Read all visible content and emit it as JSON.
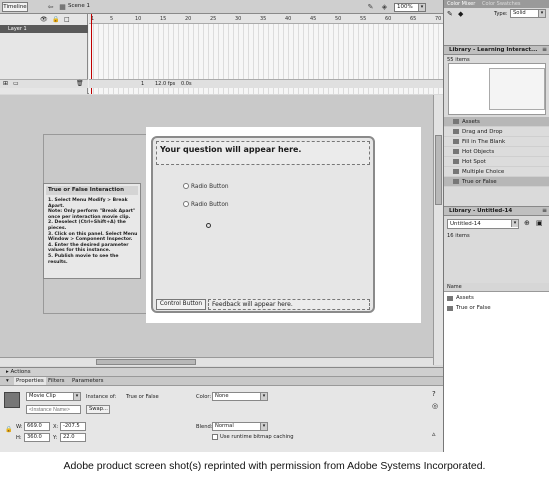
{
  "topbar": {
    "timeline_tab": "Timeline",
    "scene": "Scene 1",
    "zoom": "100%"
  },
  "timeline": {
    "layer_name": "Layer 1",
    "ruler_ticks": [
      "1",
      "5",
      "10",
      "15",
      "20",
      "25",
      "30",
      "35",
      "40",
      "45",
      "50",
      "55",
      "60",
      "65",
      "70"
    ],
    "status_frame": "1",
    "status_fps": "12.0 fps",
    "status_time": "0.0s"
  },
  "stage": {
    "info_panel": {
      "title": "True or False Interaction",
      "steps": [
        "1. Select Menu Modify > Break Apart.",
        "   Note: Only perform \"Break Apart\"",
        "   once per interaction movie clip.",
        "2. Deselect (Ctrl+Shift+A) the pieces.",
        "3. Click on this panel. Select Menu",
        "   Window > Component Inspector.",
        "4. Enter the desired parameter",
        "   values for this instance.",
        "5. Publish movie to see the results."
      ]
    },
    "question": "Your question will appear here.",
    "radio1": "Radio Button",
    "radio2": "Radio Button",
    "control_button": "Control Button",
    "feedback": "Feedback will appear here."
  },
  "actions_label": "Actions",
  "properties": {
    "tabs": [
      "Properties",
      "Filters",
      "Parameters"
    ],
    "symbol_type": "Movie Clip",
    "instance_of_label": "Instance of:",
    "instance_of_value": "True or False",
    "instance_name_placeholder": "<Instance Name>",
    "swap_label": "Swap...",
    "color_label": "Color:",
    "color_value": "None",
    "blend_label": "Blend:",
    "blend_value": "Normal",
    "bitmap_caching": "Use runtime bitmap caching",
    "w_label": "W:",
    "w_value": "669.0",
    "x_label": "X:",
    "x_value": "-207.5",
    "h_label": "H:",
    "h_value": "360.0",
    "y_label": "Y:",
    "y_value": "22.0"
  },
  "right_panel": {
    "color_tabs": [
      "Color Mixer",
      "Color Swatches"
    ],
    "color_type_label": "Type:",
    "color_type_value": "Solid",
    "library1_title": "Library - Learning Interact...",
    "library1_count": "55 items",
    "library1_items": [
      "Assets",
      "Drag and Drop",
      "Fill in The Blank",
      "Hot Objects",
      "Hot Spot",
      "Multiple Choice",
      "True or False"
    ],
    "library2_title": "Library - Untitled-14",
    "library2_select": "Untitled-14",
    "library2_count": "16 items",
    "library2_col": "Name",
    "library2_items": [
      "Assets",
      "True or False"
    ]
  },
  "caption": "Adobe product screen shot(s) reprinted with permission from Adobe Systems Incorporated."
}
